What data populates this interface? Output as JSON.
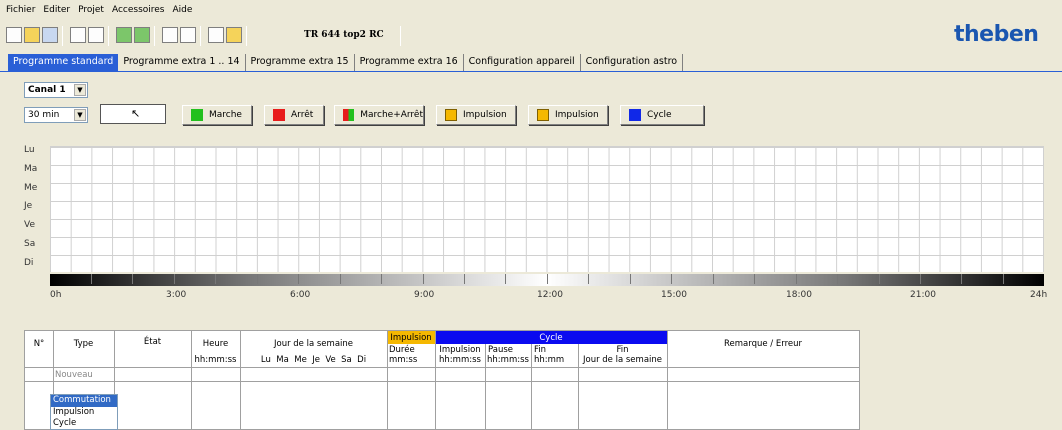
{
  "menu": [
    "Fichier",
    "Editer",
    "Projet",
    "Accessoires",
    "Aide"
  ],
  "toolbar": {
    "title": "TR 644 top2 RC",
    "logo": "theben"
  },
  "tabs": [
    {
      "label": "Programme standard",
      "active": true
    },
    {
      "label": "Programme extra 1 .. 14"
    },
    {
      "label": "Programme extra 15"
    },
    {
      "label": "Programme extra 16"
    },
    {
      "label": "Configuration appareil"
    },
    {
      "label": "Configuration astro"
    }
  ],
  "channel": {
    "value": "Canal 1"
  },
  "interval": {
    "value": "30 min"
  },
  "buttons": {
    "marche": {
      "label": "Marche",
      "color": "#22c01e"
    },
    "arret": {
      "label": "Arrêt",
      "color": "#e81c1c"
    },
    "marche_arret": {
      "label": "Marche+Arrêt"
    },
    "impulsion1": {
      "label": "Impulsion"
    },
    "impulsion2": {
      "label": "Impulsion"
    },
    "cycle": {
      "label": "Cycle",
      "color": "#1028e8"
    }
  },
  "days": [
    "Lu",
    "Ma",
    "Me",
    "Je",
    "Ve",
    "Sa",
    "Di"
  ],
  "hours": [
    "0h",
    "3:00",
    "6:00",
    "9:00",
    "12:00",
    "15:00",
    "18:00",
    "21:00",
    "24h"
  ],
  "table": {
    "col_no": "N°",
    "col_type": "Type",
    "col_etat": "État",
    "col_heure": "Heure",
    "col_heure_fmt": "hh:mm:ss",
    "col_jour": "Jour de la semaine",
    "col_jour_days": "Lu  Ma  Me  Je  Ve  Sa  Di",
    "col_impulsion": "Impulsion",
    "col_duree": "Durée",
    "col_duree_fmt": "mm:ss",
    "col_cycle": "Cycle",
    "col_cycle_impulsion": "Impulsion",
    "col_cycle_impulsion_fmt": "hh:mm:ss",
    "col_pause": "Pause",
    "col_pause_fmt": "hh:mm:ss",
    "col_fin": "Fin",
    "col_fin_fmt": "hh:mm",
    "col_fin_jour": "Fin",
    "col_fin_jour_sub": "Jour de la semaine",
    "col_remarque": "Remarque / Erreur",
    "new_row": "Nouveau"
  },
  "type_list": [
    "Commutation",
    "Impulsion",
    "Cycle"
  ],
  "colors": {
    "accent_blue": "#2a5fd6",
    "impulsion_header": "#f5b800",
    "cycle_header": "#0a0af0"
  }
}
